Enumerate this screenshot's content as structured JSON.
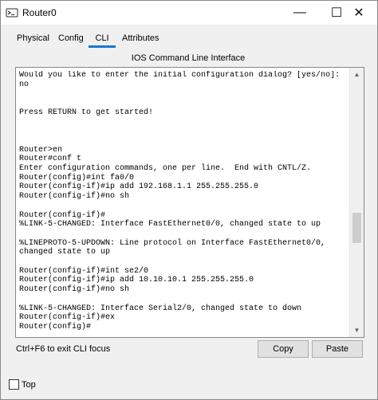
{
  "window": {
    "title": "Router0",
    "minimize_glyph": "—",
    "maximize_glyph": "☐",
    "close_glyph": "✕"
  },
  "tabs": [
    {
      "label": "Physical"
    },
    {
      "label": "Config"
    },
    {
      "label": "CLI",
      "active": true
    },
    {
      "label": "Attributes"
    }
  ],
  "cli": {
    "heading": "IOS Command Line Interface",
    "console_lines": [
      "Would you like to enter the initial configuration dialog? [yes/no]:",
      "no",
      "",
      "",
      "Press RETURN to get started!",
      "",
      "",
      "",
      "Router>en",
      "Router#conf t",
      "Enter configuration commands, one per line.  End with CNTL/Z.",
      "Router(config)#int fa0/0",
      "Router(config-if)#ip add 192.168.1.1 255.255.255.0",
      "Router(config-if)#no sh",
      "",
      "Router(config-if)#",
      "%LINK-5-CHANGED: Interface FastEthernet0/0, changed state to up",
      "",
      "%LINEPROTO-5-UPDOWN: Line protocol on Interface FastEthernet0/0,",
      "changed state to up",
      "",
      "Router(config-if)#int se2/0",
      "Router(config-if)#ip add 10.10.10.1 255.255.255.0",
      "Router(config-if)#no sh",
      "",
      "%LINK-5-CHANGED: Interface Serial2/0, changed state to down",
      "Router(config-if)#ex",
      "Router(config)#"
    ],
    "exit_hint": "Ctrl+F6 to exit CLI focus",
    "copy_label": "Copy",
    "paste_label": "Paste"
  },
  "footer": {
    "top_label": "Top",
    "top_checked": false
  },
  "colors": {
    "accent": "#1979ca",
    "background": "#f0f0f0",
    "console_bg": "#ffffff"
  }
}
